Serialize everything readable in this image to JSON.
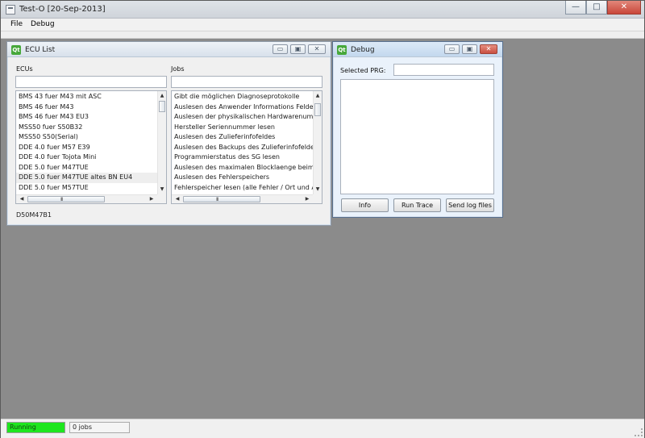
{
  "app": {
    "title": "Test-O [20-Sep-2013]",
    "minimize": "—",
    "maximize": "□",
    "close": "✕"
  },
  "menu": {
    "file": "File",
    "debug": "Debug"
  },
  "ecu_window": {
    "title": "ECU List",
    "qt_icon": "Qt",
    "minimize": "▭",
    "restore": "▣",
    "close": "✕",
    "ecus_label": "ECUs",
    "jobs_label": "Jobs",
    "ecus": [
      "BMS 43 fuer M43 mit ASC",
      "BMS 46 fuer M43",
      "BMS 46 fuer M43 EU3",
      "MSS50 fuer S50B32",
      "MSS50 S50(Serial)",
      "DDE 4.0 fuer M57 E39",
      "DDE 4.0 fuer Tojota Mini",
      "DDE 5.0 fuer M47TUE",
      "DDE 5.0 fuer M47TUE altes BN EU4",
      "DDE 5.0 fuer M57TUE"
    ],
    "selected_ecu_index": 8,
    "jobs": [
      "Gibt die möglichen Diagnoseprotokolle",
      "Auslesen des Anwender Informations Felde",
      "Auslesen der physikalischen Hardwarenumm",
      "Hersteller Seriennummer lesen",
      "Auslesen des Zulieferinfofeldes",
      "Auslesen des Backups des Zulieferinfofeldes",
      "Programmierstatus des SG lesen",
      "Auslesen des maximalen Blocklaenge beim",
      "Auslesen des Fehlerspeichers",
      "Fehlerspeicher lesen (alle Fehler / Ort und A"
    ],
    "status_text": "D50M47B1",
    "scroll_up": "▲",
    "scroll_down": "▼",
    "scroll_left": "◀",
    "scroll_right": "▶",
    "grip": "III"
  },
  "debug_window": {
    "title": "Debug",
    "qt_icon": "Qt",
    "minimize": "▭",
    "restore": "▣",
    "close": "✕",
    "selected_prg_label": "Selected PRG:",
    "selected_prg_value": "",
    "info_button": "Info",
    "run_trace_button": "Run Trace",
    "send_log_button": "Send log files"
  },
  "status": {
    "running_text": "Running",
    "running_progress": 1.0,
    "jobs_text": "0 jobs"
  }
}
